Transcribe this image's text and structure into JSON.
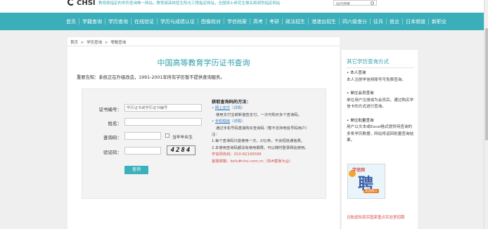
{
  "header": {
    "logo_text": "CHSI",
    "tagline": "教育部指定的学历查询唯一网站，教育部高校招生阳光工程指定网站，全国硕士研究生报名和调剂指定网站",
    "search_placeholder": "站内搜索"
  },
  "nav": {
    "items": [
      "首页",
      "学籍查询",
      "学历查询",
      "在线验证",
      "学历与成绩认证",
      "图像校对",
      "学信档案",
      "高考",
      "考研",
      "政法招生",
      "港澳台招生",
      "四六级查分",
      "征兵",
      "就业",
      "日本频道",
      "新职业"
    ]
  },
  "breadcrumb": [
    "首页",
    ">",
    "学历查询",
    ">",
    "零散查询"
  ],
  "main": {
    "title": "中国高等教育学历证书查询",
    "notice": "重要告知：系统正在升级改造，1991-2001年所有学历暂不提供查询服务。"
  },
  "form": {
    "cert_label": "证书编号：",
    "cert_placeholder": "学历证书或学历证书编号",
    "name_label": "姓名：",
    "code_label": "查询码：",
    "current_grad_label": "当年毕业生",
    "captcha_label": "验证码：",
    "captcha_text": "4284",
    "submit_label": "查询"
  },
  "howto": {
    "heading": "获取查询码的方法：",
    "opt1_link": "网上支付",
    "opt1_detail": "（详情）",
    "opt1_text": "使用支付宝或新借查支付，一次可购买多个查询码。",
    "opt2_link": "手机短信",
    "opt2_detail": "（详情）",
    "opt2_text": "通过手机号码直接购买查询码（暂不支持电信号码用户）",
    "note_label": "注：",
    "note1": "1.每个查询码只能使用一次，2元/条，不会短信通信费。",
    "note2": "2.本使用查询码都没有使用期限，可以随时登录网站使用。",
    "hotline": "学信网热线：010-82199588",
    "email": "客服邮箱：kefu#chsi.com.cn（将#替换为@）"
  },
  "sidebar": {
    "title": "其它学历查询方式",
    "personal_title": "• 本人查询",
    "personal_text": "本人注册学信网账号可免费查询。",
    "member_title": "• 单位会员查询",
    "member_text": "单位用户注册成为会员后，通过购买学信卡的方式进行查询。",
    "batch_title": "• 单位批量查询",
    "batch_text": "用户以文本或Excel格式提供待查询的多条学历数据，网站将返回批量查询结果。",
    "ad_brand": "学信网",
    "ad_char": "聘",
    "ad_tag": "欢迎加入",
    "link": "北航虚拟现实国家重点实验室招聘"
  }
}
